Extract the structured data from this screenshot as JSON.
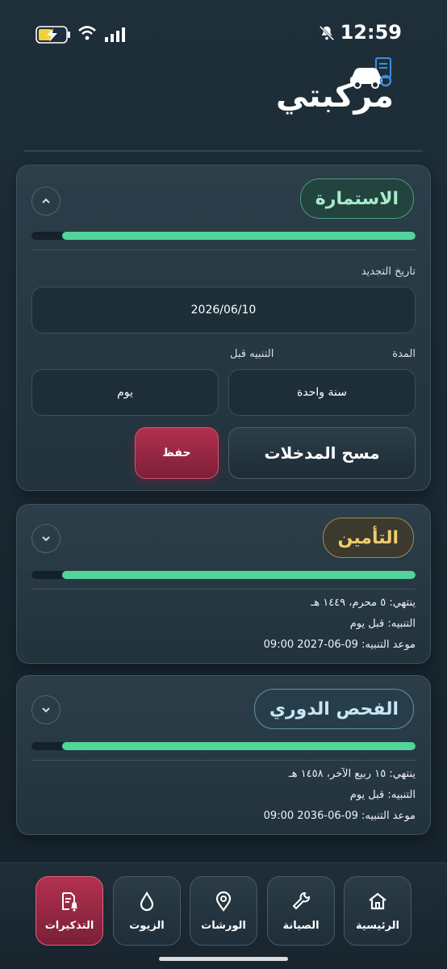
{
  "status_bar": {
    "time": "12:59"
  },
  "header": {
    "title": "مركبتي"
  },
  "cards": [
    {
      "title": "الاستمارة",
      "toggle": "^",
      "progress_fraction": 0.92,
      "renewal_label": "تاريخ التجديد",
      "renewal_value": "2026/06/10",
      "duration_label": "المدة",
      "duration_value": "سنة واحدة",
      "alert_label": "التنبيه قبل",
      "alert_value": "يوم",
      "clear_label": "مسح المدخلات",
      "save_label": "حفظ"
    },
    {
      "title": "التأمين",
      "toggle": "v",
      "progress_fraction": 0.92,
      "expires": "ينتهي: ٥ محرم، ١٤٤٩ هـ",
      "alert": "التنبيه: قبل يوم",
      "alert_time": "موعد التنبيه: 09-06-2027 09:00"
    },
    {
      "title": "الفحص الدوري",
      "toggle": "v",
      "progress_fraction": 0.92,
      "expires": "ينتهي: ١٥ ربيع الآخر، ١٤٥٨ هـ",
      "alert": "التنبيه: قبل يوم",
      "alert_time": "موعد التنبيه: 09-06-2036 09:00"
    }
  ],
  "nav": [
    {
      "label": "الرئيسية",
      "icon": "home-icon"
    },
    {
      "label": "الصيانة",
      "icon": "wrench-icon"
    },
    {
      "label": "الورشات",
      "icon": "location-pin-icon"
    },
    {
      "label": "الزيوت",
      "icon": "drop-icon"
    },
    {
      "label": "التذكيرات",
      "icon": "reminder-document-icon",
      "active": true
    }
  ],
  "colors": {
    "accent_green": "#52d49a",
    "accent_red": "#b1304e",
    "gold": "#f0cd6c"
  }
}
